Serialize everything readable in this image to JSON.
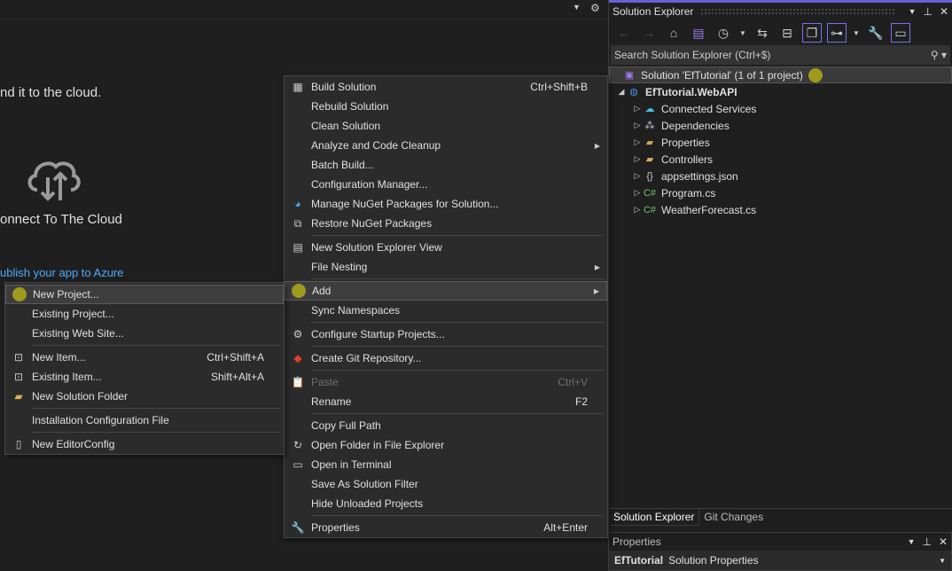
{
  "welcome": {
    "tagline": "nd it to the cloud.",
    "heading": "onnect To The Cloud",
    "link": "ublish your app to Azure",
    "cloud_icon": "cloud-upload-download-icon"
  },
  "solution_explorer": {
    "title": "Solution Explorer",
    "search_placeholder": "Search Solution Explorer (Ctrl+$)",
    "tree": [
      {
        "label": "Solution 'EfTutorial' (1 of 1 project)",
        "icon": "solution-icon",
        "level": 0,
        "selected": true
      },
      {
        "label": "EfTutorial.WebAPI",
        "icon": "web-project-icon",
        "level": 1,
        "expanded": true,
        "bold": true
      },
      {
        "label": "Connected Services",
        "icon": "connected-services-icon",
        "level": 2
      },
      {
        "label": "Dependencies",
        "icon": "dependencies-icon",
        "level": 2
      },
      {
        "label": "Properties",
        "icon": "properties-folder-icon",
        "level": 2
      },
      {
        "label": "Controllers",
        "icon": "folder-icon",
        "level": 2
      },
      {
        "label": "appsettings.json",
        "icon": "json-file-icon",
        "level": 2
      },
      {
        "label": "Program.cs",
        "icon": "csharp-file-icon",
        "level": 2
      },
      {
        "label": "WeatherForecast.cs",
        "icon": "csharp-file-icon",
        "level": 2
      }
    ],
    "tabs": [
      "Solution Explorer",
      "Git Changes"
    ]
  },
  "properties": {
    "title": "Properties",
    "object_name": "EfTutorial",
    "object_type": "Solution Properties"
  },
  "context_menu": [
    {
      "label": "Build Solution",
      "shortcut": "Ctrl+Shift+B",
      "icon": "build-icon"
    },
    {
      "label": "Rebuild Solution"
    },
    {
      "label": "Clean Solution"
    },
    {
      "label": "Analyze and Code Cleanup",
      "submenu": true
    },
    {
      "label": "Batch Build..."
    },
    {
      "label": "Configuration Manager..."
    },
    {
      "label": "Manage NuGet Packages for Solution...",
      "icon": "nuget-icon"
    },
    {
      "label": "Restore NuGet Packages",
      "icon": "restore-icon"
    },
    {
      "sep": true
    },
    {
      "label": "New Solution Explorer View",
      "icon": "new-view-icon"
    },
    {
      "label": "File Nesting",
      "submenu": true
    },
    {
      "sep": true
    },
    {
      "label": "Add",
      "submenu": true,
      "highlighted": true,
      "icon": "dot"
    },
    {
      "label": "Sync Namespaces"
    },
    {
      "sep": true
    },
    {
      "label": "Configure Startup Projects...",
      "icon": "gear-icon"
    },
    {
      "sep": true
    },
    {
      "label": "Create Git Repository...",
      "icon": "git-icon"
    },
    {
      "sep": true
    },
    {
      "label": "Paste",
      "shortcut": "Ctrl+V",
      "disabled": true,
      "icon": "paste-icon"
    },
    {
      "label": "Rename",
      "shortcut": "F2"
    },
    {
      "sep": true
    },
    {
      "label": "Copy Full Path"
    },
    {
      "label": "Open Folder in File Explorer",
      "icon": "folder-open-icon"
    },
    {
      "label": "Open in Terminal",
      "icon": "terminal-icon"
    },
    {
      "label": "Save As Solution Filter"
    },
    {
      "label": "Hide Unloaded Projects"
    },
    {
      "sep": true
    },
    {
      "label": "Properties",
      "shortcut": "Alt+Enter",
      "icon": "wrench-icon"
    }
  ],
  "add_submenu": [
    {
      "label": "New Project...",
      "highlighted": true,
      "icon": "dot"
    },
    {
      "label": "Existing Project..."
    },
    {
      "label": "Existing Web Site..."
    },
    {
      "sep": true
    },
    {
      "label": "New Item...",
      "shortcut": "Ctrl+Shift+A",
      "icon": "new-item-icon"
    },
    {
      "label": "Existing Item...",
      "shortcut": "Shift+Alt+A",
      "icon": "existing-item-icon"
    },
    {
      "label": "New Solution Folder",
      "icon": "new-folder-icon"
    },
    {
      "sep": true
    },
    {
      "label": "Installation Configuration File"
    },
    {
      "sep": true
    },
    {
      "label": "New EditorConfig",
      "icon": "file-icon"
    }
  ],
  "colors": {
    "accent": "#6b5fd8",
    "highlight_dot": "#9e9a1d",
    "link": "#4daafc"
  }
}
